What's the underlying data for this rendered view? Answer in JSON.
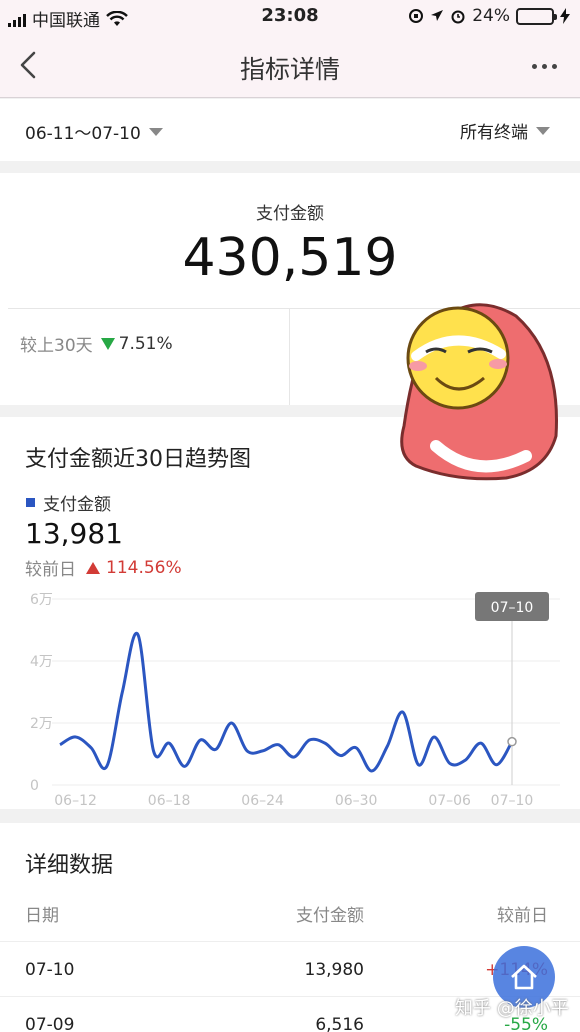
{
  "status_bar": {
    "carrier": "中国联通",
    "time": "23:08",
    "battery": "24%",
    "battery_level": 0.24
  },
  "nav": {
    "title": "指标详情"
  },
  "filters": {
    "date_range": "06-11～07-10",
    "terminal": "所有终端"
  },
  "summary": {
    "label": "支付金额",
    "value": "430,519",
    "compare_label": "较上30天",
    "compare_value": "7.51%",
    "compare_direction": "down"
  },
  "trend": {
    "title": "支付金额近30日趋势图",
    "legend": "支付金额",
    "current_value": "13,981",
    "compare_label": "较前日",
    "compare_value": "114.56%",
    "compare_direction": "up",
    "tooltip": "07–10"
  },
  "chart_data": {
    "type": "line",
    "series": [
      {
        "name": "支付金额",
        "color": "#2b56c1",
        "x": [
          "06-11",
          "06-12",
          "06-13",
          "06-14",
          "06-15",
          "06-16",
          "06-17",
          "06-18",
          "06-19",
          "06-20",
          "06-21",
          "06-22",
          "06-23",
          "06-24",
          "06-25",
          "06-26",
          "06-27",
          "06-28",
          "06-29",
          "06-30",
          "07-01",
          "07-02",
          "07-03",
          "07-04",
          "07-05",
          "07-06",
          "07-07",
          "07-08",
          "07-09",
          "07-10"
        ],
        "values": [
          13000,
          15500,
          12000,
          6000,
          30000,
          48500,
          11000,
          13500,
          6000,
          14500,
          11500,
          20000,
          11000,
          11000,
          13000,
          9000,
          14500,
          13500,
          9500,
          12000,
          4500,
          12500,
          23500,
          6500,
          15500,
          7000,
          8000,
          13500,
          6516,
          13980
        ]
      }
    ],
    "x_ticks": [
      "06–12",
      "06–18",
      "06–24",
      "06–30",
      "07–06",
      "07–10"
    ],
    "y_ticks": [
      "0",
      "2万",
      "4万",
      "6万"
    ],
    "ylim": [
      0,
      60000
    ],
    "grid": true
  },
  "details": {
    "title": "详细数据",
    "columns": [
      "日期",
      "支付金额",
      "较前日"
    ],
    "rows": [
      {
        "date": "07-10",
        "amount": "13,980",
        "change": "+114%",
        "direction": "up"
      },
      {
        "date": "07-09",
        "amount": "6,516",
        "change": "-55%",
        "direction": "down"
      }
    ]
  },
  "watermark": "知乎 @徐小平"
}
